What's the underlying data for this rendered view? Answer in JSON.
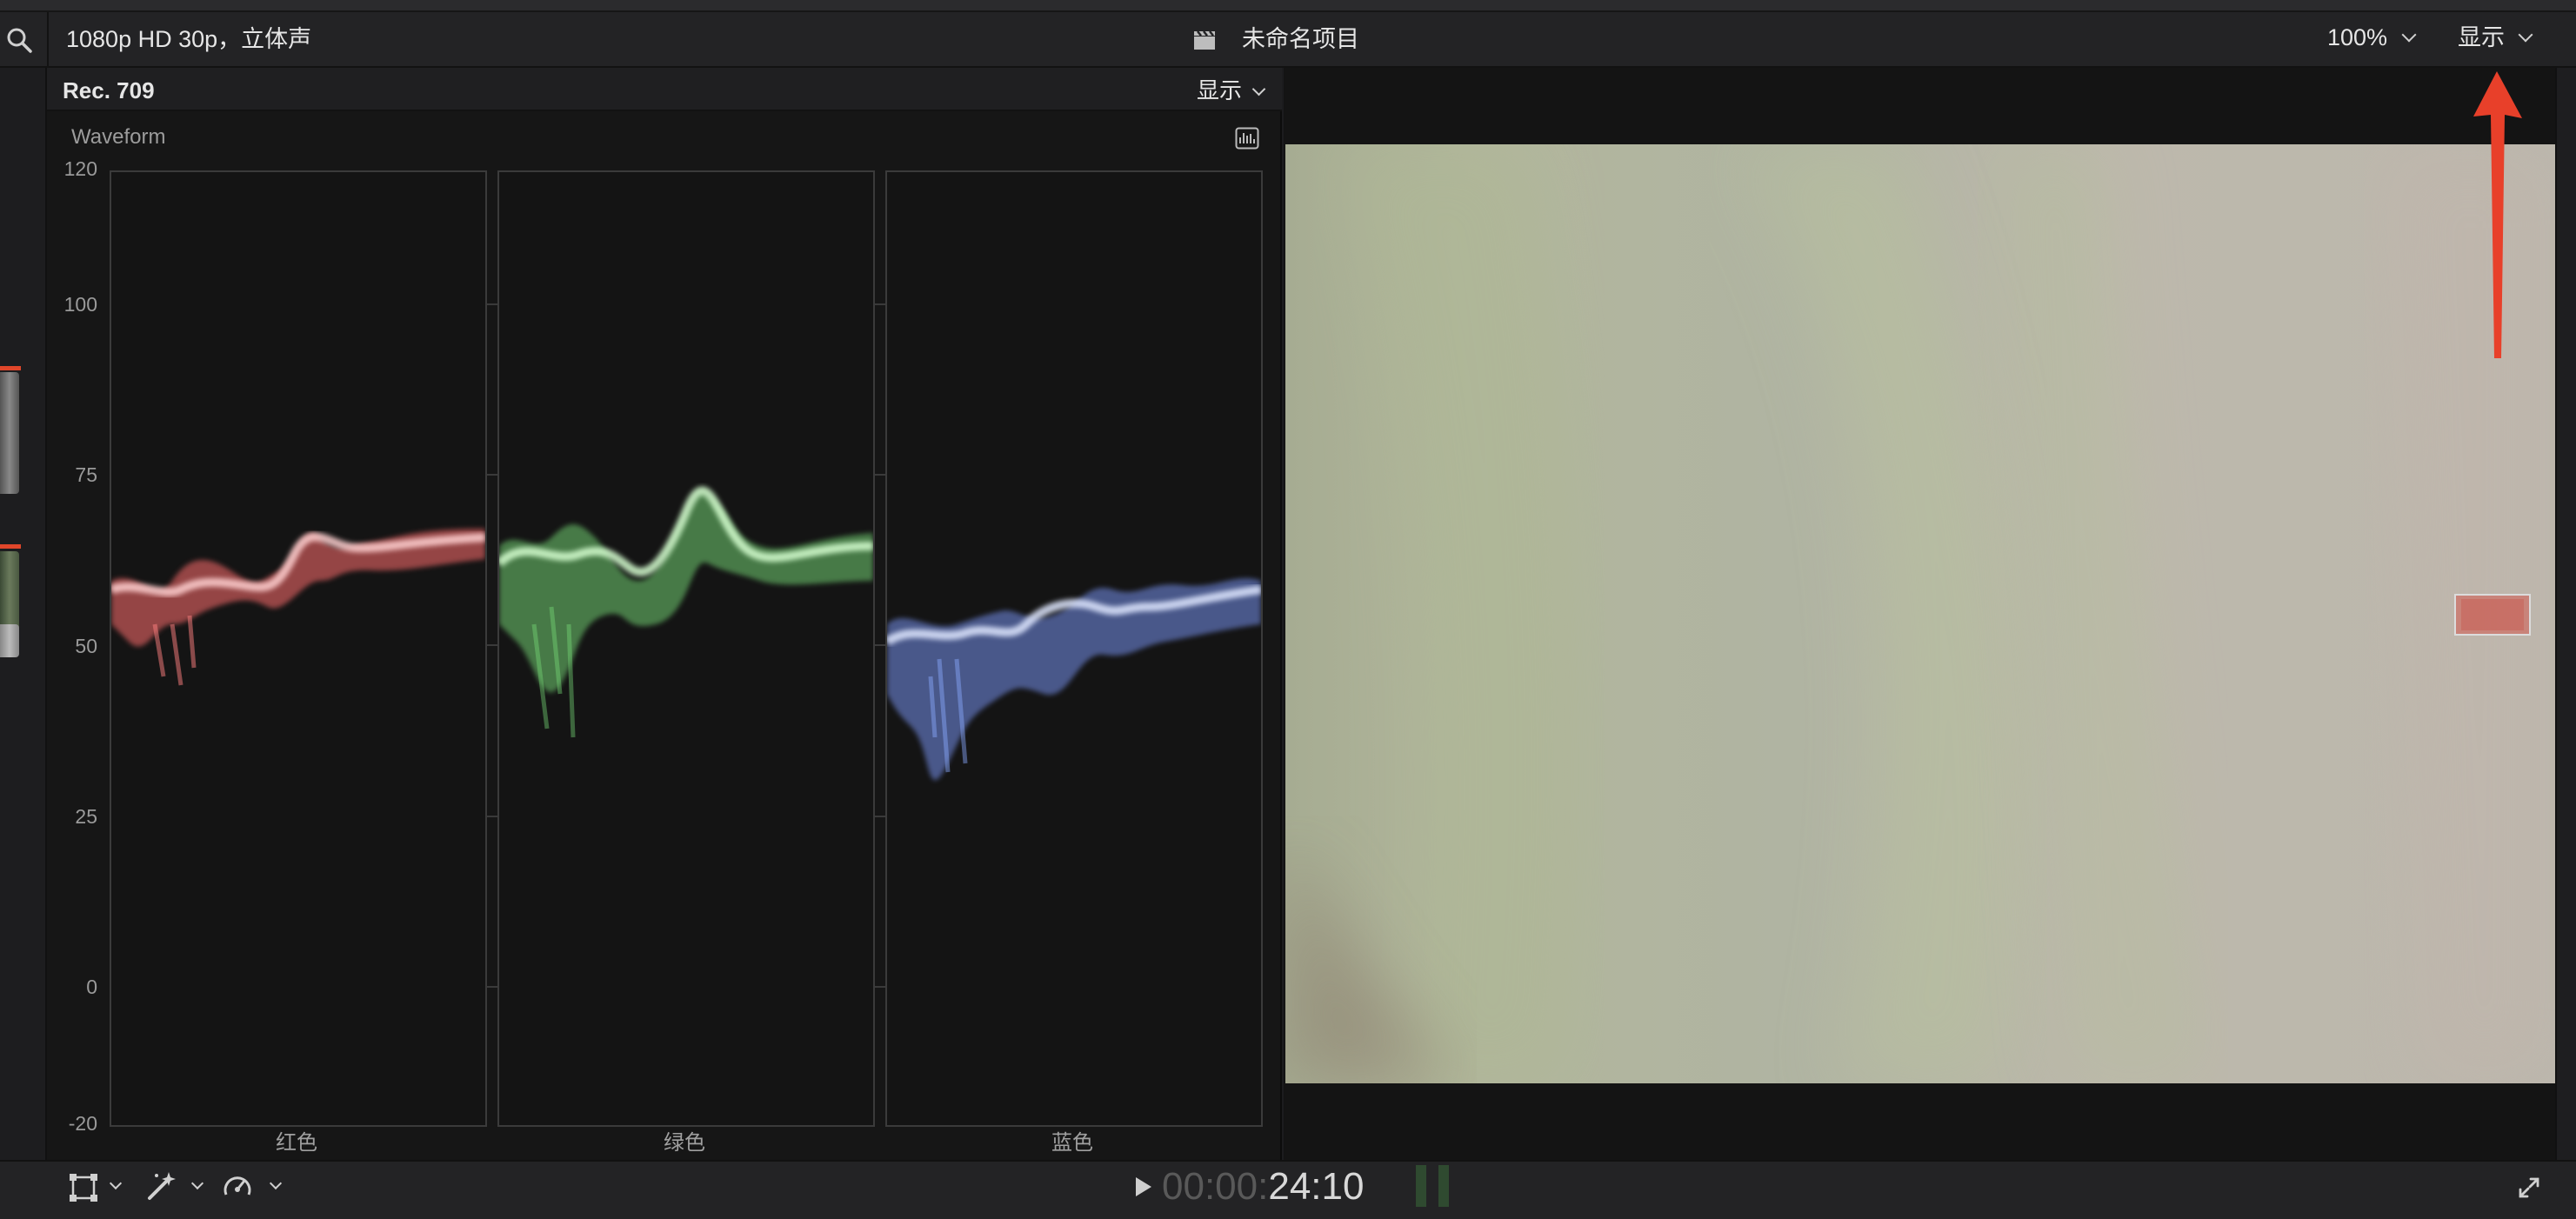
{
  "toolbar": {
    "format_label": "1080p HD 30p，立体声",
    "project_title": "未命名项目",
    "zoom_label": "100%",
    "view_label": "显示"
  },
  "scopes": {
    "colorspace_label": "Rec. 709",
    "view_label": "显示",
    "scope_type": "Waveform",
    "y_axis_ticks": [
      "120",
      "100",
      "75",
      "50",
      "25",
      "0",
      "-20"
    ],
    "channels": [
      {
        "label": "红色",
        "color": "#ff7a7a"
      },
      {
        "label": "绿色",
        "color": "#8ee08a"
      },
      {
        "label": "蓝色",
        "color": "#8aaaff"
      }
    ]
  },
  "viewer": {
    "annotation": "red-arrow-pointing-up",
    "annotation_color": "#e8402a"
  },
  "bottombar": {
    "timecode_dim": "00:00:",
    "timecode_bright": "24:10"
  },
  "icons": [
    "search-icon",
    "clapper-icon",
    "transform-icon",
    "magic-wand-icon",
    "speed-icon",
    "play-icon",
    "fullscreen-icon",
    "waveform-settings-icon"
  ]
}
